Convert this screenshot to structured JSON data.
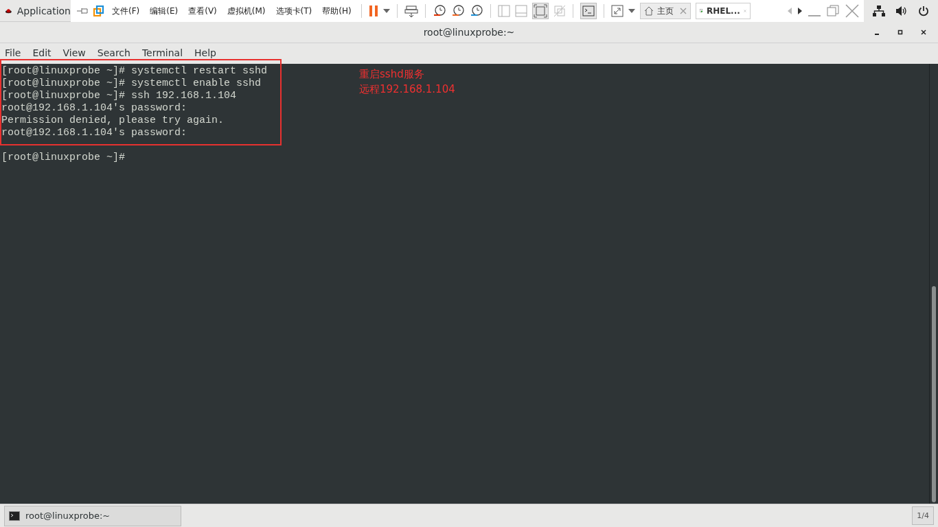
{
  "top_bar": {
    "applications": "Application"
  },
  "vm_toolbar": {
    "menus": [
      "文件(F)",
      "编辑(E)",
      "查看(V)",
      "虚拟机(M)",
      "选项卡(T)",
      "帮助(H)"
    ],
    "tabs": [
      {
        "label": "主页",
        "selected": false
      },
      {
        "label": "RHEL...",
        "selected": true
      }
    ]
  },
  "window": {
    "title": "root@linuxprobe:~"
  },
  "menu": [
    "File",
    "Edit",
    "View",
    "Search",
    "Terminal",
    "Help"
  ],
  "terminal": {
    "blocks": [
      {
        "lines": [
          "[root@linuxprobe ~]# systemctl restart sshd",
          "[root@linuxprobe ~]# systemctl enable sshd",
          "[root@linuxprobe ~]# ssh 192.168.1.104",
          "root@192.168.1.104's password:",
          "Permission denied, please try again.",
          "root@192.168.1.104's password:"
        ]
      },
      {
        "lines": [
          "[root@linuxprobe ~]#"
        ]
      }
    ]
  },
  "annotations": [
    "重启sshd服务",
    "远程192.168.1.104"
  ],
  "taskbar": {
    "task": "root@linuxprobe:~",
    "workspace": "1/4"
  }
}
